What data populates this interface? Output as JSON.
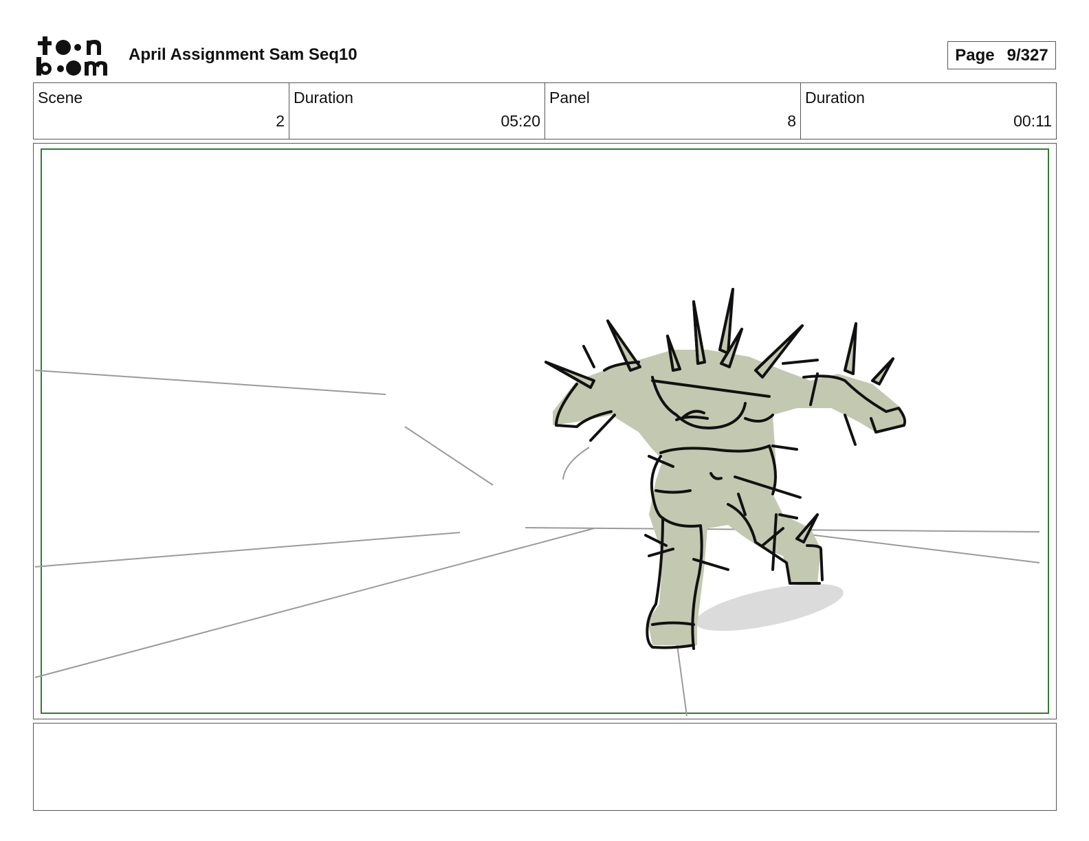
{
  "header": {
    "logo_text_top": "toon",
    "logo_text_bottom": "boom",
    "title": "April Assignment Sam Seq10",
    "page_label": "Page",
    "page_value": "9/327"
  },
  "info": {
    "scene_label": "Scene",
    "scene_value": "2",
    "scene_duration_label": "Duration",
    "scene_duration_value": "05:20",
    "panel_label": "Panel",
    "panel_value": "8",
    "panel_duration_label": "Duration",
    "panel_duration_value": "00:11"
  },
  "panel": {
    "frame_color": "#2e7d32",
    "character_fill": "#c3c8b0",
    "line_color": "#111111"
  },
  "notes": {
    "dialogue": ""
  }
}
